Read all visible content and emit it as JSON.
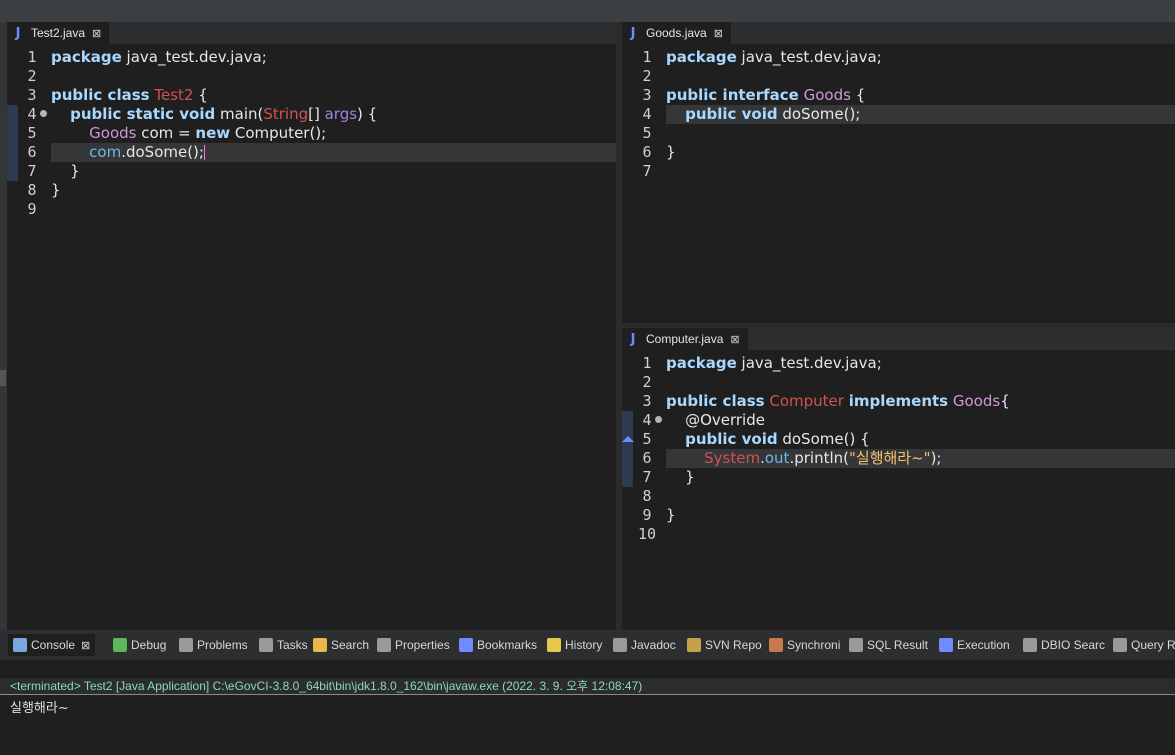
{
  "editors": {
    "test2": {
      "tab_label": "Test2.java",
      "icon": "java-file-icon",
      "lines": [
        {
          "n": "1",
          "tokens": [
            {
              "t": "package",
              "c": "kw"
            },
            {
              "t": " java_test.dev.java;",
              "c": ""
            }
          ]
        },
        {
          "n": "2",
          "tokens": []
        },
        {
          "n": "3",
          "tokens": [
            {
              "t": "public class",
              "c": "kw"
            },
            {
              "t": " ",
              "c": ""
            },
            {
              "t": "Test2",
              "c": "cls"
            },
            {
              "t": " {",
              "c": ""
            }
          ]
        },
        {
          "n": "4",
          "fold": true,
          "tokens": [
            {
              "t": "    ",
              "c": ""
            },
            {
              "t": "public static void",
              "c": "kw"
            },
            {
              "t": " main(",
              "c": ""
            },
            {
              "t": "String",
              "c": "cls"
            },
            {
              "t": "[] ",
              "c": ""
            },
            {
              "t": "args",
              "c": "prm"
            },
            {
              "t": ") {",
              "c": ""
            }
          ]
        },
        {
          "n": "5",
          "tokens": [
            {
              "t": "        ",
              "c": ""
            },
            {
              "t": "Goods",
              "c": "itf"
            },
            {
              "t": " com = ",
              "c": ""
            },
            {
              "t": "new",
              "c": "kw"
            },
            {
              "t": " Computer();",
              "c": ""
            }
          ]
        },
        {
          "n": "6",
          "highlight": true,
          "caret": true,
          "tokens": [
            {
              "t": "        ",
              "c": ""
            },
            {
              "t": "com",
              "c": "fld"
            },
            {
              "t": ".doSome();",
              "c": ""
            }
          ]
        },
        {
          "n": "7",
          "tokens": [
            {
              "t": "    }",
              "c": ""
            }
          ]
        },
        {
          "n": "8",
          "tokens": [
            {
              "t": "}",
              "c": ""
            }
          ]
        },
        {
          "n": "9",
          "tokens": []
        }
      ]
    },
    "goods": {
      "tab_label": "Goods.java",
      "icon": "java-file-icon",
      "lines": [
        {
          "n": "1",
          "tokens": [
            {
              "t": "package",
              "c": "kw"
            },
            {
              "t": " java_test.dev.java;",
              "c": ""
            }
          ]
        },
        {
          "n": "2",
          "tokens": []
        },
        {
          "n": "3",
          "tokens": [
            {
              "t": "public interface",
              "c": "kw"
            },
            {
              "t": " ",
              "c": ""
            },
            {
              "t": "Goods",
              "c": "itf"
            },
            {
              "t": " {",
              "c": ""
            }
          ]
        },
        {
          "n": "4",
          "highlight": true,
          "tokens": [
            {
              "t": "    ",
              "c": ""
            },
            {
              "t": "public void",
              "c": "kw"
            },
            {
              "t": " doSome();",
              "c": ""
            }
          ]
        },
        {
          "n": "5",
          "tokens": []
        },
        {
          "n": "6",
          "tokens": [
            {
              "t": "}",
              "c": ""
            }
          ]
        },
        {
          "n": "7",
          "tokens": []
        }
      ]
    },
    "computer": {
      "tab_label": "Computer.java",
      "icon": "java-file-icon",
      "lines": [
        {
          "n": "1",
          "tokens": [
            {
              "t": "package",
              "c": "kw"
            },
            {
              "t": " java_test.dev.java;",
              "c": ""
            }
          ]
        },
        {
          "n": "2",
          "tokens": []
        },
        {
          "n": "3",
          "tokens": [
            {
              "t": "public class",
              "c": "kw"
            },
            {
              "t": " ",
              "c": ""
            },
            {
              "t": "Computer",
              "c": "cls"
            },
            {
              "t": " ",
              "c": ""
            },
            {
              "t": "implements",
              "c": "kw"
            },
            {
              "t": " ",
              "c": ""
            },
            {
              "t": "Goods",
              "c": "itf"
            },
            {
              "t": "{",
              "c": ""
            }
          ]
        },
        {
          "n": "4",
          "fold": true,
          "tokens": [
            {
              "t": "    @Override",
              "c": ""
            }
          ]
        },
        {
          "n": "5",
          "override": true,
          "tokens": [
            {
              "t": "    ",
              "c": ""
            },
            {
              "t": "public void",
              "c": "kw"
            },
            {
              "t": " doSome() {",
              "c": ""
            }
          ]
        },
        {
          "n": "6",
          "highlight": true,
          "tokens": [
            {
              "t": "        ",
              "c": ""
            },
            {
              "t": "System",
              "c": "cls"
            },
            {
              "t": ".",
              "c": ""
            },
            {
              "t": "out",
              "c": "fld"
            },
            {
              "t": ".println(",
              "c": ""
            },
            {
              "t": "\"실행해라~\"",
              "c": "str"
            },
            {
              "t": ");",
              "c": ""
            }
          ]
        },
        {
          "n": "7",
          "tokens": [
            {
              "t": "    }",
              "c": ""
            }
          ]
        },
        {
          "n": "8",
          "tokens": []
        },
        {
          "n": "9",
          "tokens": [
            {
              "t": "}",
              "c": ""
            }
          ]
        },
        {
          "n": "10",
          "tokens": []
        }
      ]
    }
  },
  "console": {
    "tabs": [
      {
        "label": "Console",
        "icon": "console-icon",
        "color": "#7aa7e0",
        "active": true,
        "closable": true
      },
      {
        "label": "Debug",
        "icon": "bug-icon",
        "color": "#5cb85c"
      },
      {
        "label": "Problems",
        "icon": "problems-icon",
        "color": "#9a9a9a"
      },
      {
        "label": "Tasks",
        "icon": "tasks-icon",
        "color": "#9a9a9a"
      },
      {
        "label": "Search",
        "icon": "search-icon",
        "color": "#e8b84a"
      },
      {
        "label": "Properties",
        "icon": "properties-icon",
        "color": "#9a9a9a"
      },
      {
        "label": "Bookmarks",
        "icon": "bookmark-icon",
        "color": "#6f8bff"
      },
      {
        "label": "History",
        "icon": "history-icon",
        "color": "#e8c84a"
      },
      {
        "label": "Javadoc",
        "icon": "javadoc-icon",
        "color": "#9a9a9a"
      },
      {
        "label": "SVN Repo",
        "icon": "svn-icon",
        "color": "#c8a04a"
      },
      {
        "label": "Synchroni",
        "icon": "synchronize-icon",
        "color": "#c87a4a"
      },
      {
        "label": "SQL Result",
        "icon": "sql-result-icon",
        "color": "#9a9a9a"
      },
      {
        "label": "Execution",
        "icon": "execution-icon",
        "color": "#6f8bff"
      },
      {
        "label": "DBIO Searc",
        "icon": "dbio-search-icon",
        "color": "#9a9a9a"
      },
      {
        "label": "Query R",
        "icon": "query-result-icon",
        "color": "#9a9a9a"
      }
    ],
    "status": "<terminated> Test2 [Java Application] C:\\eGovCI-3.8.0_64bit\\bin\\jdk1.8.0_162\\bin\\javaw.exe (2022. 3. 9. 오후 12:08:47)",
    "output": "실행해라~"
  }
}
